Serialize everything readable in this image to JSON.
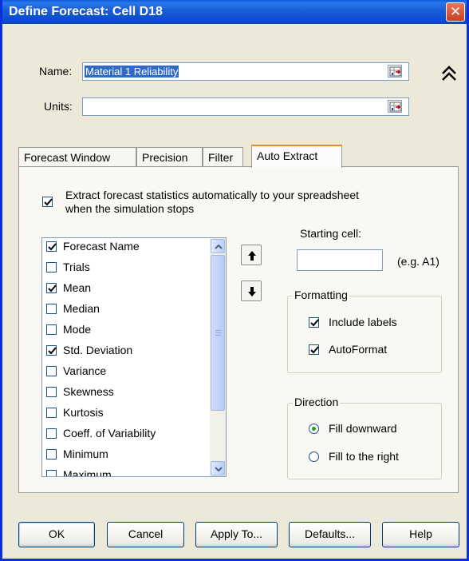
{
  "window": {
    "title": "Define Forecast: Cell D18",
    "close_glyph": "✕"
  },
  "name": {
    "label": "Name:",
    "value": "Material 1 Reliability"
  },
  "units": {
    "label": "Units:",
    "value": ""
  },
  "tabs": [
    {
      "label": "Forecast Window",
      "active": false
    },
    {
      "label": "Precision",
      "active": false
    },
    {
      "label": "Filter",
      "active": false
    },
    {
      "label": "Auto Extract",
      "active": true
    }
  ],
  "auto_extract": {
    "extract_label_line1": "Extract forecast statistics automatically to your spreadsheet",
    "extract_label_line2": "when the simulation stops",
    "extract_checked": true,
    "statistics": [
      {
        "label": "Forecast Name",
        "checked": true
      },
      {
        "label": "Trials",
        "checked": false
      },
      {
        "label": "Mean",
        "checked": true
      },
      {
        "label": "Median",
        "checked": false
      },
      {
        "label": "Mode",
        "checked": false
      },
      {
        "label": "Std. Deviation",
        "checked": true
      },
      {
        "label": "Variance",
        "checked": false
      },
      {
        "label": "Skewness",
        "checked": false
      },
      {
        "label": "Kurtosis",
        "checked": false
      },
      {
        "label": "Coeff. of Variability",
        "checked": false
      },
      {
        "label": "Minimum",
        "checked": false
      },
      {
        "label": "Maximum",
        "checked": false
      }
    ],
    "starting_cell": {
      "label": "Starting cell:",
      "value": "",
      "hint": "(e.g. A1)"
    },
    "formatting": {
      "caption": "Formatting",
      "include_labels": {
        "label": "Include labels",
        "checked": true
      },
      "autoformat": {
        "label": "AutoFormat",
        "checked": true
      }
    },
    "direction": {
      "caption": "Direction",
      "fill_downward": {
        "label": "Fill downward",
        "selected": true
      },
      "fill_right": {
        "label": "Fill to the right",
        "selected": false
      }
    }
  },
  "buttons": {
    "ok": "OK",
    "cancel": "Cancel",
    "apply_to": "Apply To...",
    "defaults": "Defaults...",
    "help": "Help"
  },
  "colors": {
    "title_bar": "#0a5ad8",
    "selection": "#316ac5",
    "close_button": "#c9401f"
  }
}
